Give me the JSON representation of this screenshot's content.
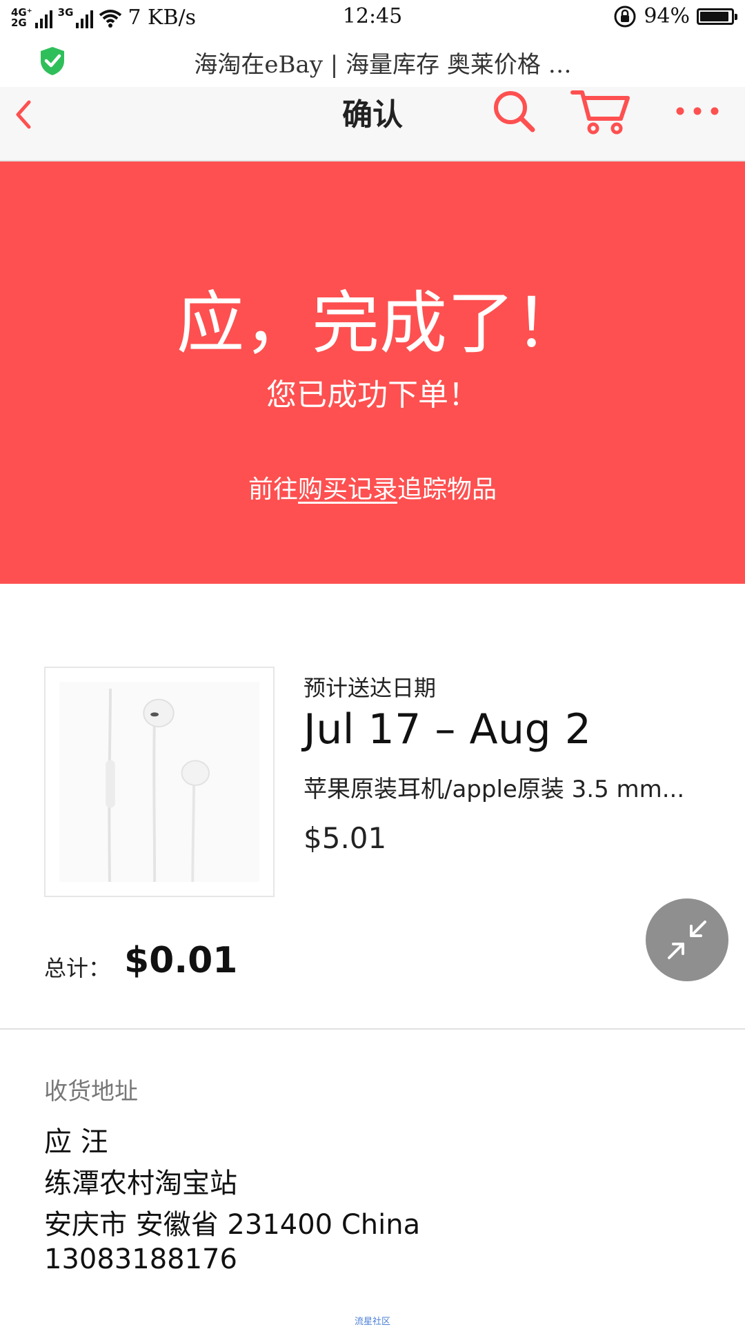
{
  "status_bar": {
    "network_top": "4G⁺",
    "network_bottom": "2G",
    "network_secondary": "3G",
    "speed": "7 KB/s",
    "time": "12:45",
    "battery": "94%",
    "battery_level": 0.94,
    "wifi_icon": "wifi-icon",
    "rotation_lock_icon": "rotation-lock-icon",
    "battery_icon": "battery-icon"
  },
  "browser": {
    "page_title": "海淘在eBay | 海量库存 奥莱价格 …",
    "secure_icon": "shield-check-icon",
    "secure_color": "#2fbf5a"
  },
  "header": {
    "title": "确认",
    "back_icon": "chevron-left-icon",
    "search_icon": "search-icon",
    "cart_icon": "cart-icon",
    "more_icon": "more-icon",
    "accent_color": "#fe5050"
  },
  "banner": {
    "title": "应，完成了！",
    "subtitle": "您已成功下单！",
    "link_prefix": "前往",
    "link_text": "购买记录",
    "link_suffix": "追踪物品",
    "background_color": "#fe5050"
  },
  "order_item": {
    "image_alt": "earphones-image",
    "delivery_label": "预计送达日期",
    "delivery_date": "Jul 17 – Aug 2",
    "title": "苹果原装耳机/apple原装 3.5 mm...",
    "price": "$5.01"
  },
  "total": {
    "label": "总计：",
    "value": "$0.01"
  },
  "fab": {
    "icon": "collapse-icon"
  },
  "shipping": {
    "label": "收货地址",
    "name": "应 汪",
    "line1": "练潭农村淘宝站",
    "line2": "安庆市 安徽省 231400 China",
    "phone": "13083188176"
  },
  "watermark": "流星社区"
}
